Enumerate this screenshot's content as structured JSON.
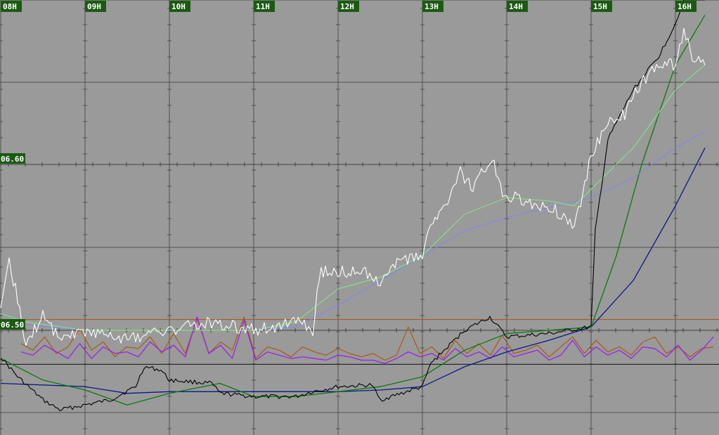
{
  "chart_data": {
    "type": "line",
    "time_labels": [
      "08H",
      "09H",
      "10H",
      "11H",
      "12H",
      "13H",
      "14H",
      "15H",
      "16H"
    ],
    "price_labels": [
      {
        "value": 6.6,
        "text": "06.60"
      },
      {
        "value": 6.5,
        "text": "06.50"
      }
    ],
    "ylim": [
      6.42,
      6.72
    ],
    "x_unit": "hours",
    "grid": true,
    "colors": {
      "background": "#9a9a9a",
      "grid": "#505050",
      "label_box": "#1b5a12",
      "label_text": "#ffffff",
      "price": "#ffffff",
      "ma_fast": "#84e884",
      "ma_slow": "#7f86f0",
      "lower_line": "#000000",
      "lower_ma_fast": "#0a7a0a",
      "lower_ma_slow": "#0a1a8a",
      "oscillator_a": "#a85a10",
      "oscillator_b": "#9a1aee",
      "reference_line": "#a8520f",
      "baseline": "#111111"
    },
    "price_series": {
      "name": "",
      "points": [
        [
          8.0,
          6.51
        ],
        [
          8.1,
          6.54
        ],
        [
          8.2,
          6.52
        ],
        [
          8.3,
          6.49
        ],
        [
          8.5,
          6.51
        ],
        [
          8.7,
          6.495
        ],
        [
          9.0,
          6.5
        ],
        [
          9.5,
          6.495
        ],
        [
          10.0,
          6.5
        ],
        [
          10.5,
          6.505
        ],
        [
          11.0,
          6.5
        ],
        [
          11.5,
          6.505
        ],
        [
          11.7,
          6.5
        ],
        [
          11.75,
          6.52
        ],
        [
          11.8,
          6.535
        ],
        [
          12.0,
          6.535
        ],
        [
          12.3,
          6.535
        ],
        [
          12.5,
          6.53
        ],
        [
          12.7,
          6.54
        ],
        [
          13.0,
          6.545
        ],
        [
          13.1,
          6.565
        ],
        [
          13.3,
          6.575
        ],
        [
          13.45,
          6.595
        ],
        [
          13.6,
          6.585
        ],
        [
          13.7,
          6.595
        ],
        [
          13.85,
          6.6
        ],
        [
          13.95,
          6.58
        ],
        [
          14.1,
          6.58
        ],
        [
          14.3,
          6.575
        ],
        [
          14.5,
          6.575
        ],
        [
          14.7,
          6.568
        ],
        [
          14.8,
          6.562
        ],
        [
          15.0,
          6.605
        ],
        [
          15.2,
          6.625
        ],
        [
          15.4,
          6.63
        ],
        [
          15.6,
          6.65
        ],
        [
          15.8,
          6.66
        ],
        [
          16.0,
          6.66
        ],
        [
          16.1,
          6.68
        ],
        [
          16.2,
          6.665
        ],
        [
          16.35,
          6.66
        ]
      ]
    },
    "ma_fast_series": {
      "name": "",
      "points": [
        [
          8.0,
          6.51
        ],
        [
          8.3,
          6.505
        ],
        [
          9.0,
          6.5
        ],
        [
          10.0,
          6.5
        ],
        [
          11.0,
          6.5
        ],
        [
          11.5,
          6.505
        ],
        [
          12.0,
          6.525
        ],
        [
          12.5,
          6.532
        ],
        [
          13.0,
          6.545
        ],
        [
          13.5,
          6.57
        ],
        [
          14.0,
          6.58
        ],
        [
          14.5,
          6.578
        ],
        [
          14.8,
          6.575
        ],
        [
          15.0,
          6.585
        ],
        [
          15.5,
          6.61
        ],
        [
          16.0,
          6.645
        ],
        [
          16.35,
          6.66
        ]
      ]
    },
    "ma_slow_series": {
      "name": "",
      "points": [
        [
          8.0,
          6.505
        ],
        [
          9.0,
          6.5
        ],
        [
          10.0,
          6.5
        ],
        [
          11.0,
          6.5
        ],
        [
          11.5,
          6.502
        ],
        [
          12.0,
          6.515
        ],
        [
          12.5,
          6.53
        ],
        [
          13.0,
          6.545
        ],
        [
          13.5,
          6.56
        ],
        [
          14.0,
          6.568
        ],
        [
          14.5,
          6.574
        ],
        [
          15.0,
          6.58
        ],
        [
          15.5,
          6.592
        ],
        [
          16.0,
          6.61
        ],
        [
          16.35,
          6.62
        ]
      ]
    },
    "lower_series": {
      "name": "",
      "points": [
        [
          8.0,
          6.484
        ],
        [
          8.2,
          6.472
        ],
        [
          8.5,
          6.458
        ],
        [
          8.7,
          6.452
        ],
        [
          8.9,
          6.454
        ],
        [
          9.3,
          6.458
        ],
        [
          9.6,
          6.466
        ],
        [
          9.7,
          6.478
        ],
        [
          9.9,
          6.476
        ],
        [
          10.0,
          6.47
        ],
        [
          10.5,
          6.468
        ],
        [
          10.6,
          6.462
        ],
        [
          11.0,
          6.46
        ],
        [
          11.5,
          6.46
        ],
        [
          11.7,
          6.463
        ],
        [
          12.0,
          6.466
        ],
        [
          12.4,
          6.467
        ],
        [
          12.5,
          6.458
        ],
        [
          13.0,
          6.466
        ],
        [
          13.1,
          6.48
        ],
        [
          13.5,
          6.5
        ],
        [
          13.8,
          6.508
        ],
        [
          14.0,
          6.496
        ],
        [
          14.5,
          6.498
        ],
        [
          15.0,
          6.502
        ],
        [
          15.05,
          6.56
        ],
        [
          15.2,
          6.615
        ],
        [
          15.5,
          6.645
        ],
        [
          15.8,
          6.665
        ],
        [
          16.0,
          6.685
        ],
        [
          16.1,
          6.7
        ],
        [
          16.2,
          6.715
        ],
        [
          16.35,
          6.71
        ]
      ]
    },
    "lower_ma_fast_series": {
      "name": "",
      "points": [
        [
          8.0,
          6.483
        ],
        [
          8.5,
          6.47
        ],
        [
          9.0,
          6.464
        ],
        [
          9.5,
          6.455
        ],
        [
          10.0,
          6.462
        ],
        [
          10.6,
          6.468
        ],
        [
          11.0,
          6.46
        ],
        [
          11.5,
          6.46
        ],
        [
          12.0,
          6.463
        ],
        [
          12.5,
          6.466
        ],
        [
          13.0,
          6.472
        ],
        [
          13.5,
          6.488
        ],
        [
          14.0,
          6.498
        ],
        [
          14.5,
          6.5
        ],
        [
          15.0,
          6.502
        ],
        [
          15.3,
          6.545
        ],
        [
          15.6,
          6.6
        ],
        [
          16.0,
          6.66
        ],
        [
          16.35,
          6.69
        ]
      ]
    },
    "lower_ma_slow_series": {
      "name": "",
      "points": [
        [
          8.0,
          6.468
        ],
        [
          9.0,
          6.466
        ],
        [
          9.5,
          6.462
        ],
        [
          10.0,
          6.463
        ],
        [
          11.0,
          6.463
        ],
        [
          12.0,
          6.463
        ],
        [
          12.5,
          6.464
        ],
        [
          13.0,
          6.466
        ],
        [
          13.5,
          6.478
        ],
        [
          14.0,
          6.487
        ],
        [
          14.5,
          6.494
        ],
        [
          15.0,
          6.502
        ],
        [
          15.5,
          6.53
        ],
        [
          16.0,
          6.575
        ],
        [
          16.35,
          6.61
        ]
      ]
    },
    "reference_value": 6.5065,
    "baseline_value": 6.4795,
    "oscillator_a": {
      "name": "",
      "values": [
        6.492,
        6.488,
        6.496,
        6.486,
        6.49,
        6.501,
        6.488,
        6.493,
        6.484,
        6.49,
        6.489,
        6.496,
        6.486,
        6.498,
        6.486,
        6.507,
        6.486,
        6.493,
        6.488,
        6.508,
        6.483,
        6.49,
        6.488,
        6.484,
        6.49,
        6.487,
        6.485,
        6.489,
        6.486,
        6.484,
        6.486,
        6.482,
        6.485,
        6.502,
        6.486,
        6.49,
        6.483,
        6.494,
        6.486,
        6.492,
        6.485,
        6.497,
        6.486,
        6.488,
        6.491,
        6.484,
        6.49,
        6.496,
        6.486,
        6.494,
        6.487,
        6.49,
        6.485,
        6.493,
        6.496,
        6.486,
        6.49,
        6.484,
        6.489,
        6.49
      ]
    },
    "oscillator_b": {
      "name": "",
      "values": [
        6.487,
        6.485,
        6.491,
        6.487,
        6.483,
        6.492,
        6.483,
        6.49,
        6.486,
        6.487,
        6.484,
        6.493,
        6.487,
        6.491,
        6.484,
        6.508,
        6.486,
        6.491,
        6.483,
        6.506,
        6.482,
        6.487,
        6.485,
        6.483,
        6.484,
        6.483,
        6.482,
        6.485,
        6.484,
        6.482,
        6.482,
        6.48,
        6.483,
        6.487,
        6.484,
        6.486,
        6.482,
        6.489,
        6.484,
        6.487,
        6.483,
        6.49,
        6.484,
        6.486,
        6.488,
        6.482,
        6.485,
        6.494,
        6.484,
        6.49,
        6.485,
        6.488,
        6.483,
        6.49,
        6.489,
        6.484,
        6.491,
        6.482,
        6.488,
        6.496
      ]
    }
  }
}
